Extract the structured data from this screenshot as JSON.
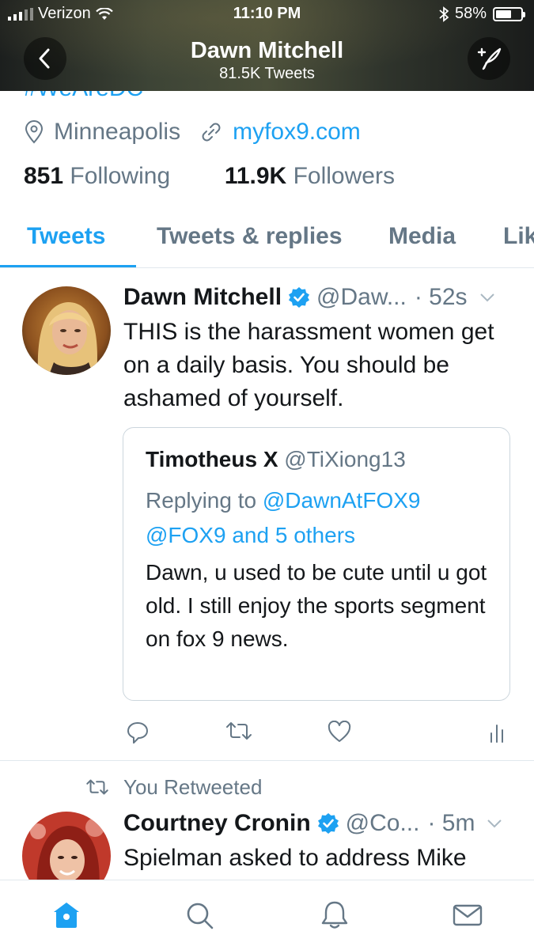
{
  "status_bar": {
    "carrier": "Verizon",
    "time": "11:10 PM",
    "battery": "58%",
    "battery_level": 0.58
  },
  "header": {
    "title": "Dawn Mitchell",
    "subtitle": "81.5K Tweets",
    "back_icon": "chevron-left-icon",
    "compose_icon": "compose-tweet-icon"
  },
  "profile": {
    "hashtag_partial": "#WeAreDC",
    "location": "Minneapolis",
    "website": "myfox9.com",
    "following_count": "851",
    "following_label": "Following",
    "followers_count": "11.9K",
    "followers_label": "Followers"
  },
  "tabs": [
    {
      "label": "Tweets",
      "active": true
    },
    {
      "label": "Tweets & replies",
      "active": false
    },
    {
      "label": "Media",
      "active": false
    },
    {
      "label": "Lik",
      "active": false
    }
  ],
  "tweets": [
    {
      "name": "Dawn Mitchell",
      "handle": "@Daw...",
      "time": "· 52s",
      "text": "THIS is the harassment women get on a daily basis. You should be ashamed of yourself.",
      "quote": {
        "name": "Timotheus X",
        "handle": "@TiXiong13",
        "replying_prefix": "Replying to",
        "replying_mention": "@DawnAtFOX9",
        "replying_line2_mention": "@FOX9",
        "replying_line2_suffix": "and 5 others",
        "text": "Dawn, u used to be cute until u got old. I still enjoy the sports segment on fox 9 news."
      }
    },
    {
      "retweet_label": "You Retweeted",
      "name": "Courtney Cronin",
      "handle": "@Co...",
      "time": "· 5m",
      "text": "Spielman asked to address Mike"
    }
  ],
  "bottom_nav": [
    "home-icon",
    "search-icon",
    "notifications-bell-icon",
    "messages-envelope-icon"
  ],
  "colors": {
    "accent": "#1da1f2",
    "secondary_text": "#657786",
    "border": "#e1e8ed"
  }
}
